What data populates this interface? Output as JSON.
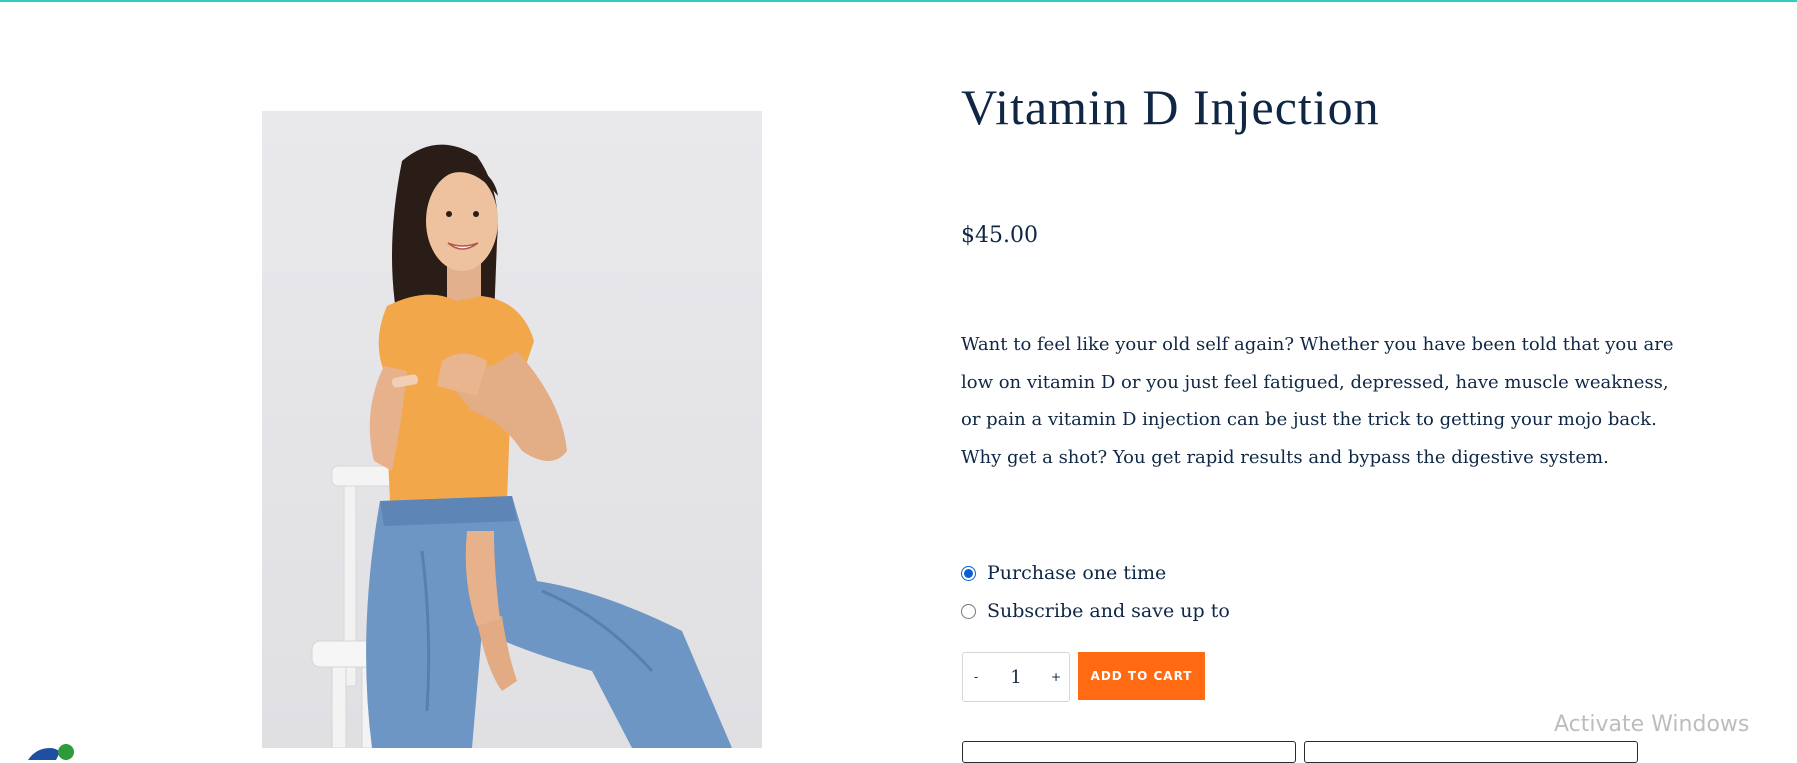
{
  "product": {
    "title": "Vitamin D Injection",
    "price": "$45.00",
    "description_lines": [
      "Want to feel like your old self again? Whether you have been told that you are",
      "low on vitamin D or you just feel fatigued, depressed, have muscle weakness,",
      "or pain a vitamin D injection can be just the trick to getting your mojo back.",
      "Why get a shot? You get rapid results and bypass the digestive system."
    ]
  },
  "purchase_options": [
    {
      "label": "Purchase one time",
      "selected": true
    },
    {
      "label": "Subscribe and save up to",
      "selected": false
    }
  ],
  "quantity": {
    "minus": "-",
    "value": "1",
    "plus": "+"
  },
  "cart": {
    "add_label": "ADD TO CART"
  },
  "os": {
    "watermark": "Activate Windows"
  },
  "colors": {
    "accent": "#ff6a12",
    "text": "#0f2744",
    "top_border": "#2fcfc0",
    "radio": "#0b5fd6"
  }
}
